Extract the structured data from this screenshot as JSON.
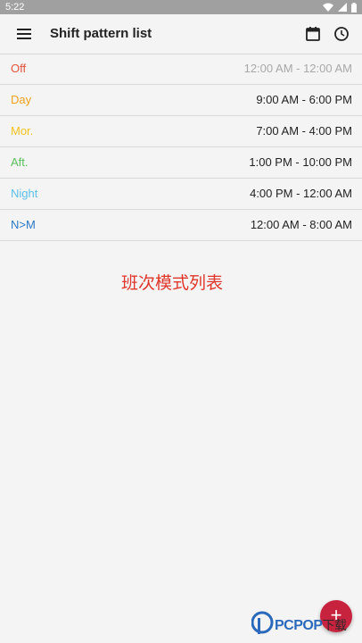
{
  "status_bar": {
    "time": "5:22"
  },
  "app_bar": {
    "title": "Shift pattern list"
  },
  "shifts": [
    {
      "name": "Off",
      "time": "12:00 AM - 12:00 AM",
      "color": "#e2533a",
      "time_color": "#a8a8a8"
    },
    {
      "name": "Day",
      "time": "9:00 AM - 6:00 PM",
      "color": "#f0a020",
      "time_color": "#222222"
    },
    {
      "name": "Mor.",
      "time": "7:00 AM - 4:00 PM",
      "color": "#f3c31a",
      "time_color": "#222222"
    },
    {
      "name": "Aft.",
      "time": "1:00 PM - 10:00 PM",
      "color": "#5cc05c",
      "time_color": "#222222"
    },
    {
      "name": "Night",
      "time": "4:00 PM - 12:00 AM",
      "color": "#5bc0e8",
      "time_color": "#222222"
    },
    {
      "name": "N>M",
      "time": "12:00 AM - 8:00 AM",
      "color": "#2a79c8",
      "time_color": "#222222"
    }
  ],
  "caption": "班次模式列表",
  "fab": {
    "label": "+"
  },
  "watermark": {
    "brand": "PCPOP",
    "suffix": "下载"
  }
}
